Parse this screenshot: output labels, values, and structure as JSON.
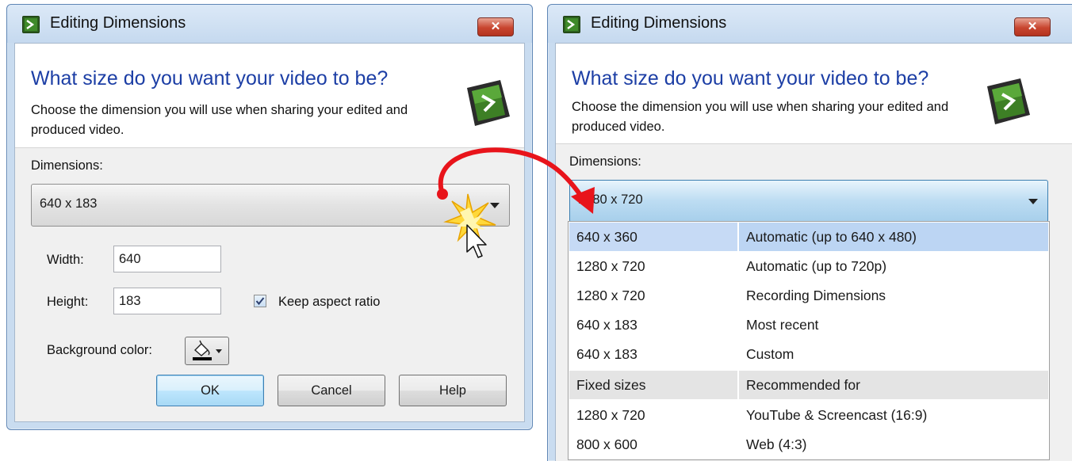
{
  "left_dialog": {
    "title": "Editing Dimensions",
    "close_label": "✕",
    "heading": "What size do you want your video to be?",
    "description": "Choose the dimension you will use when sharing your edited and produced video.",
    "dimensions_label": "Dimensions:",
    "dimensions_value": "640 x 183",
    "width_label": "Width:",
    "width_value": "640",
    "height_label": "Height:",
    "height_value": "183",
    "keep_aspect_label": "Keep aspect ratio",
    "keep_aspect_checked": true,
    "background_color_label": "Background color:",
    "ok_label": "OK",
    "cancel_label": "Cancel",
    "help_label": "Help"
  },
  "right_dialog": {
    "title": "Editing Dimensions",
    "close_label": "✕",
    "heading": "What size do you want your video to be?",
    "description": "Choose the dimension you will use when sharing your edited and produced video.",
    "dimensions_label": "Dimensions:",
    "dimensions_value": "1280 x 720",
    "dropdown": {
      "options": [
        {
          "size": "640 x 360",
          "desc": "Automatic (up to 640 x 480)",
          "selected": true
        },
        {
          "size": "1280 x 720",
          "desc": "Automatic (up to 720p)"
        },
        {
          "size": "1280 x 720",
          "desc": "Recording Dimensions"
        },
        {
          "size": "640 x 183",
          "desc": "Most recent"
        },
        {
          "size": "640 x 183",
          "desc": "Custom"
        }
      ],
      "fixed_header": {
        "size": "Fixed sizes",
        "desc": "Recommended for"
      },
      "fixed_options": [
        {
          "size": "1280 x 720",
          "desc": "YouTube & Screencast (16:9)"
        },
        {
          "size": "800 x 600",
          "desc": "Web (4:3)"
        }
      ]
    }
  },
  "colors": {
    "heading": "#1c3ea5",
    "annotation_arrow": "#e8141b",
    "selection": "#c6daf5"
  }
}
